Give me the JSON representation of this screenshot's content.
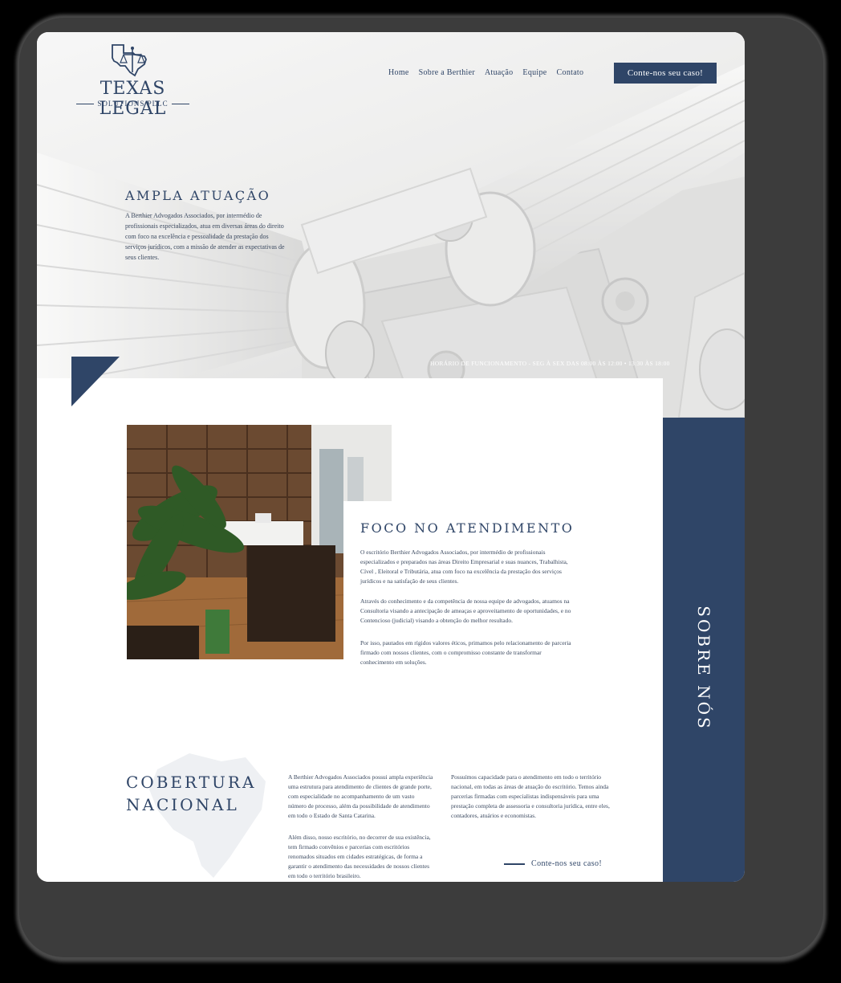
{
  "brand": {
    "name": "TEXAS LEGAL",
    "subtitle": "SOLUTIONS PLLC"
  },
  "nav": {
    "items": [
      "Home",
      "Sobre a Berthier",
      "Atuação",
      "Equipe",
      "Contato"
    ],
    "cta_label": "Conte-nos seu caso!"
  },
  "hero": {
    "title": "AMPLA ATUAÇÃO",
    "text": "A Berthier Advogados Associados, por intermédio de profissionais especializados, atua em diversas áreas do direito com foco na excelência e pessoalidade da prestação dos serviços jurídicos, com a missão de atender as expectativas de seus clientes.",
    "hours": "HORÁRIO DE FUNCIONAMENTO - SEG À SEX DAS 08:00 ÀS 12:00 • 13:30 ÀS 18:00"
  },
  "foco": {
    "title": "FOCO NO ATENDIMENTO",
    "paragraphs": [
      "O escritório Berthier Advogados Associados, por intermédio de profissionais especializados e preparados nas áreas Direito Empresarial e suas nuances, Trabalhista, Cível , Eleitoral e Tributária, atua com foco na excelência da prestação dos serviços jurídicos e na satisfação de seus clientes.",
      "Através do conhecimento e da competência de nossa equipe de advogados, atuamos na Consultoria visando a antecipação de ameaças e aproveitamento de oportunidades, e no Contencioso (judicial) visando a obtenção do melhor resultado.",
      "Por isso, pautados em rígidos valores éticos, primamos pelo relacionamento de parceria firmado com nossos clientes, com o compromisso constante de transformar conhecimento em soluções."
    ]
  },
  "sidebar": {
    "label": "SOBRE NÓS"
  },
  "cobertura": {
    "title_line1": "COBERTURA",
    "title_line2": "NACIONAL",
    "col1": [
      "A Berthier Advogados Associados possui ampla experiência uma estrutura para atendimento de clientes de grande porte, com especialidade no acompanhamento de um vasto número de processo, além da possibilidade de atendimento em todo o Estado de Santa Catarina.",
      "Além disso, nosso escritório, no decorrer de sua existência, tem firmado convênios e parcerias com escritórios renomados situados em cidades estratégicas, de forma a garantir o atendimento das necessidades de nossos clientes em todo o território brasileiro."
    ],
    "col2": "Possuímos capacidade para o atendimento em todo o território nacional, em todas as áreas de atuação do escritório. Temos ainda parcerias firmadas com especialistas indispensáveis para uma prestação completa de assessoria e consultoria jurídica, entre eles, contadores, atuários e economistas.",
    "cta_label": "Conte-nos seu caso!"
  },
  "colors": {
    "navy": "#2f4567",
    "marble": "#e4e4e3"
  }
}
